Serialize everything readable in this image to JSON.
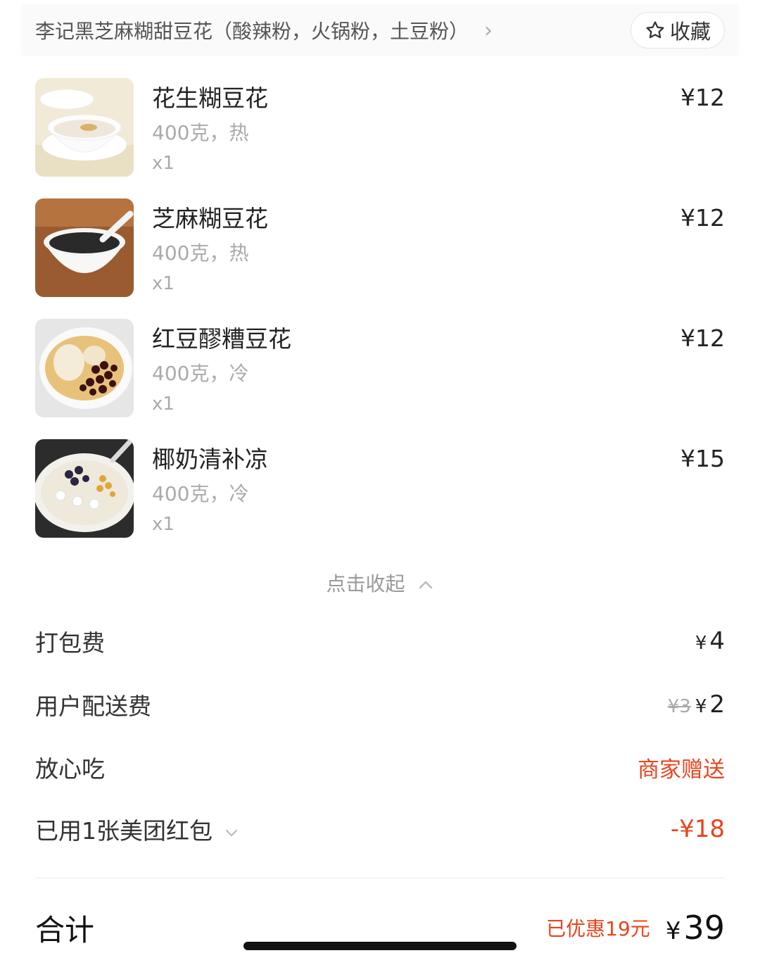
{
  "store": {
    "name": "李记黑芝麻糊甜豆花（酸辣粉，火锅粉，土豆粉）",
    "favorite_label": "收藏"
  },
  "items": [
    {
      "name": "花生糊豆花",
      "spec": "400克，热",
      "qty": "x1",
      "price": "¥12"
    },
    {
      "name": "芝麻糊豆花",
      "spec": "400克，热",
      "qty": "x1",
      "price": "¥12"
    },
    {
      "name": "红豆醪糟豆花",
      "spec": "400克，冷",
      "qty": "x1",
      "price": "¥12"
    },
    {
      "name": "椰奶清补凉",
      "spec": "400克，冷",
      "qty": "x1",
      "price": "¥15"
    }
  ],
  "collapse_label": "点击收起",
  "fees": {
    "packing": {
      "label": "打包费",
      "currency": "¥",
      "value": "4"
    },
    "delivery": {
      "label": "用户配送费",
      "original": "¥3",
      "currency": "¥",
      "value": "2"
    },
    "safe_eat": {
      "label": "放心吃",
      "value": "商家赠送"
    },
    "coupon": {
      "label": "已用1张美团红包",
      "value": "-¥18"
    }
  },
  "total": {
    "label": "合计",
    "discount_text": "已优惠19元",
    "currency": "¥",
    "value": "39"
  },
  "colors": {
    "accent_red": "#e8441e"
  }
}
